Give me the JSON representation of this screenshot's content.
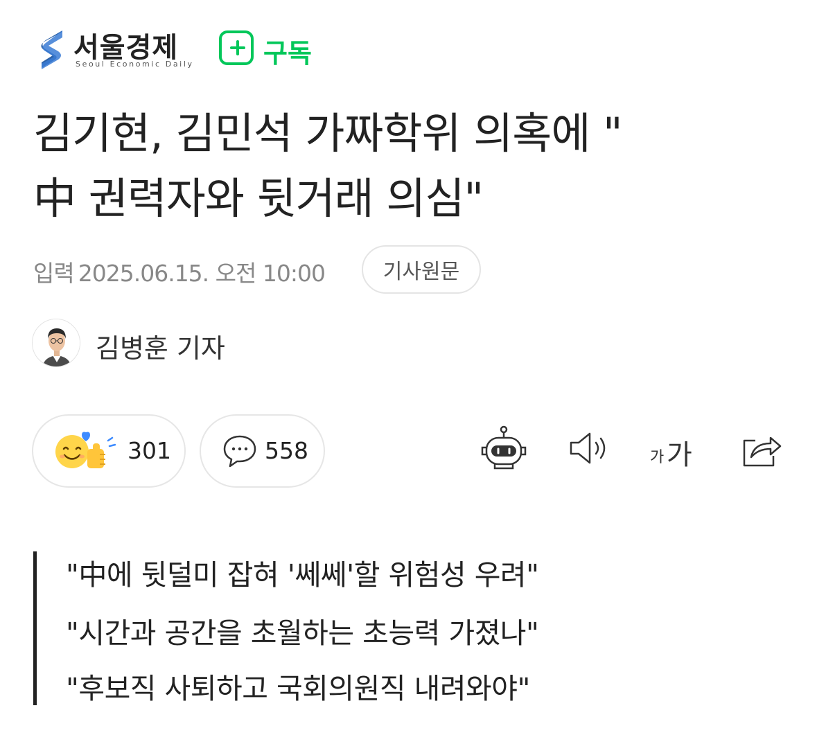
{
  "header": {
    "logo_name": "서울경제",
    "logo_sub": "Seoul Economic Daily",
    "subscribe_label": "구독"
  },
  "article": {
    "title_line1": "김기현, 김민석 가짜학위 의혹에 \"",
    "title_line2": "中 권력자와 뒷거래 의심\"",
    "date_label": "입력",
    "date_value": "2025.06.15. 오전 10:00",
    "original_button": "기사원문",
    "reporter": "김병훈 기자"
  },
  "reactions": {
    "like_count": "301",
    "comment_count": "558"
  },
  "tools": {
    "font_size_small": "가",
    "font_size_large": "가"
  },
  "subheads": [
    "\"中에 뒷덜미 잡혀 '쎄쎄'할 위험성 우려\"",
    "\"시간과 공간을 초월하는 초능력 가졌나\"",
    "\"후보직 사퇴하고 국회의원직 내려와야\""
  ],
  "colors": {
    "brand_blue": "#2e63a8",
    "subscribe_green": "#03c75a"
  }
}
